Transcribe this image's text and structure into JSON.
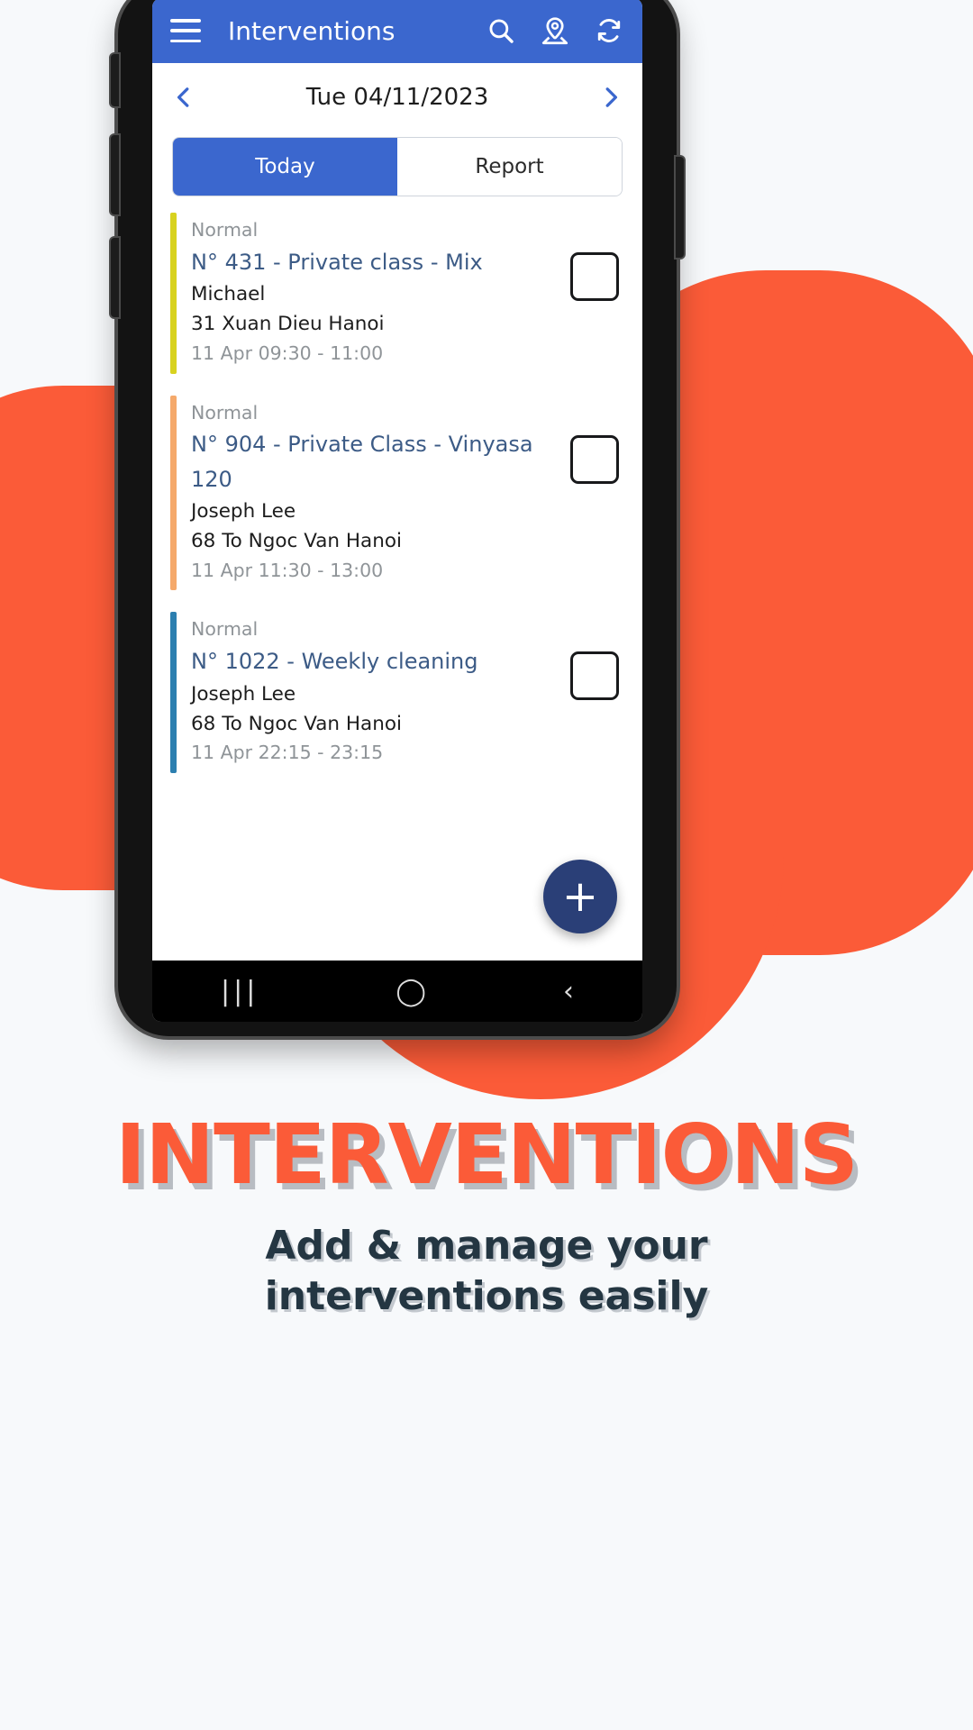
{
  "app": {
    "title": "Interventions",
    "menu_icon": "hamburger-menu-icon",
    "search_icon": "search-icon",
    "map_icon": "map-pin-icon",
    "refresh_icon": "refresh-icon",
    "accent_color": "#3b67ce"
  },
  "datebar": {
    "prev_label": "‹",
    "date": "Tue 04/11/2023",
    "next_label": "›"
  },
  "tabs": [
    {
      "label": "Today",
      "active": true
    },
    {
      "label": "Report",
      "active": false
    }
  ],
  "list": [
    {
      "status": "Normal",
      "title": "N° 431 - Private class - Mix",
      "person": "Michael",
      "address": "31 Xuan Dieu Hanoi",
      "time": "11 Apr 09:30 - 11:00",
      "accent": "#d8d21f",
      "checked": false
    },
    {
      "status": "Normal",
      "title": "N° 904 - Private Class - Vinyasa 120",
      "person": "Joseph Lee",
      "address": "68 To Ngoc Van Hanoi",
      "time": "11 Apr 11:30 - 13:00",
      "accent": "#f5a96b",
      "checked": false
    },
    {
      "status": "Normal",
      "title": "N° 1022 - Weekly cleaning",
      "person": "Joseph Lee",
      "address": "68 To Ngoc Van Hanoi",
      "time": "11 Apr 22:15 - 23:15",
      "accent": "#2c7fb0",
      "checked": false
    }
  ],
  "fab": {
    "label": "+",
    "color": "#2a3f77"
  },
  "navbar": {
    "recents": "|||",
    "home": "◯",
    "back": "‹"
  },
  "marketing": {
    "headline": "INTERVENTIONS",
    "subhead_line1": "Add & manage your",
    "subhead_line2": "interventions easily",
    "headline_color": "#fb5b38",
    "subhead_color": "#243642"
  }
}
